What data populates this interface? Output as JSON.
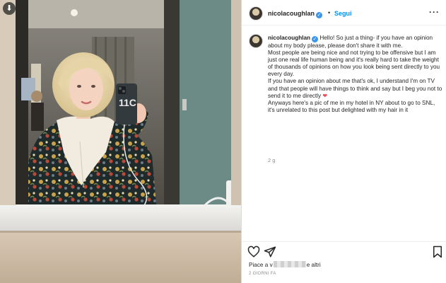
{
  "post": {
    "username": "nicolacoughlan",
    "verified_glyph": "✓",
    "separator": "•",
    "follow_label": "Segui",
    "more_glyph": "···",
    "caption": [
      "Hello! So just a thing- if you have an opinion about my body please, please don't share it with me.",
      "Most people are being nice and not trying to be offensive but I am just one real life human being and it's really hard to take the weight of thousands of opinions on how you look being sent directly to you every day.",
      "If you have an opinion about me that's ok, I understand I'm on TV and that people will have things to think and say but I beg you not to send it to me directly",
      "Anyways here's a pic of me in my hotel in NY about to go to SNL, it's unrelated to this post but delighted with my hair in it"
    ],
    "heart_emoji": "❤",
    "comment_time": "2 g",
    "likes_prefix": "Piace a",
    "likes_hidden_start": "v",
    "likes_hidden_end": "e",
    "likes_suffix": "altri",
    "date": "2 GIORNI FA"
  },
  "photo": {
    "download_glyph": "⬇",
    "phone_case_text": "11C"
  },
  "colors": {
    "link_blue": "#0095f6",
    "verified_blue": "#3897f0",
    "heart_red": "#ed4956",
    "muted": "#8e8e8e"
  },
  "icons": [
    "download-icon",
    "verified-icon",
    "more-options-icon",
    "heart-icon",
    "share-icon",
    "bookmark-icon"
  ]
}
